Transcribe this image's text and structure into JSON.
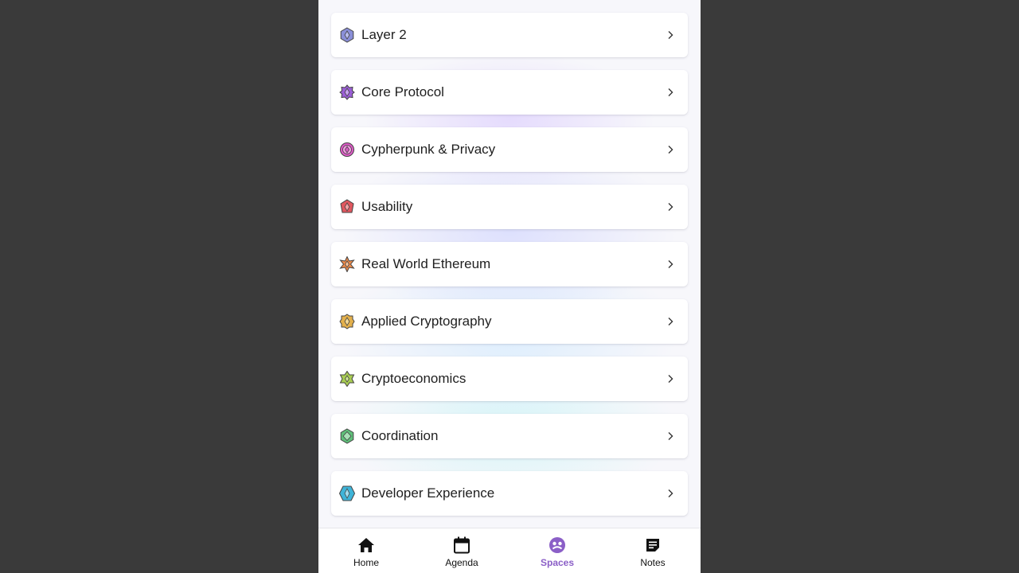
{
  "spaces": [
    {
      "label": "Layer 2",
      "icon": "layer-2-icon",
      "color": "#8a8fd8"
    },
    {
      "label": "Core Protocol",
      "icon": "core-protocol-icon",
      "color": "#9b5fd6"
    },
    {
      "label": "Cypherpunk & Privacy",
      "icon": "cypherpunk-privacy-icon",
      "color": "#e05ac8"
    },
    {
      "label": "Usability",
      "icon": "usability-icon",
      "color": "#e0575f"
    },
    {
      "label": "Real World Ethereum",
      "icon": "real-world-ethereum-icon",
      "color": "#ec8a4a"
    },
    {
      "label": "Applied Cryptography",
      "icon": "applied-cryptography-icon",
      "color": "#e3b04c"
    },
    {
      "label": "Cryptoeconomics",
      "icon": "cryptoeconomics-icon",
      "color": "#a8cc52"
    },
    {
      "label": "Coordination",
      "icon": "coordination-icon",
      "color": "#5fbf79"
    },
    {
      "label": "Developer Experience",
      "icon": "developer-experience-icon",
      "color": "#3fb4d8"
    }
  ],
  "nav": {
    "home": "Home",
    "agenda": "Agenda",
    "spaces": "Spaces",
    "notes": "Notes",
    "active": "spaces",
    "active_color": "#8b5fc7"
  }
}
